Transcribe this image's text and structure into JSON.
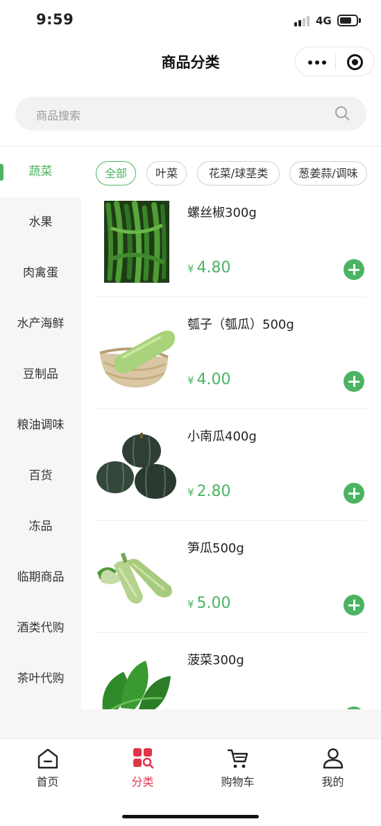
{
  "status_bar": {
    "time": "9:59",
    "network": "4G"
  },
  "navbar": {
    "title": "商品分类"
  },
  "search": {
    "placeholder": "商品搜索"
  },
  "sidebar": {
    "active_index": 0,
    "items": [
      {
        "label": "蔬菜"
      },
      {
        "label": "水果"
      },
      {
        "label": "肉禽蛋"
      },
      {
        "label": "水产海鲜"
      },
      {
        "label": "豆制品"
      },
      {
        "label": "粮油调味"
      },
      {
        "label": "百货"
      },
      {
        "label": "冻品"
      },
      {
        "label": "临期商品"
      },
      {
        "label": "酒类代购"
      },
      {
        "label": "茶叶代购"
      }
    ]
  },
  "subcategories": [
    {
      "label": "全部",
      "active": true
    },
    {
      "label": "叶菜",
      "active": false
    },
    {
      "label": "花菜/球茎类",
      "active": false
    },
    {
      "label": "葱姜蒜/调味",
      "active": false
    }
  ],
  "products": [
    {
      "name": "螺丝椒300g",
      "currency": "¥",
      "price": "4.80",
      "image": "green-peppers"
    },
    {
      "name": "瓠子（瓠瓜）500g",
      "currency": "¥",
      "price": "4.00",
      "image": "gourd-in-basket"
    },
    {
      "name": "小南瓜400g",
      "currency": "¥",
      "price": "2.80",
      "image": "small-pumpkins"
    },
    {
      "name": "笋瓜500g",
      "currency": "¥",
      "price": "5.00",
      "image": "zucchini"
    },
    {
      "name": "菠菜300g",
      "currency": "¥",
      "price": "",
      "image": "spinach"
    }
  ],
  "tabbar": {
    "active_index": 1,
    "tabs": [
      {
        "label": "首页",
        "icon": "home-icon"
      },
      {
        "label": "分类",
        "icon": "category-icon"
      },
      {
        "label": "购物车",
        "icon": "cart-icon"
      },
      {
        "label": "我的",
        "icon": "profile-icon"
      }
    ]
  },
  "colors": {
    "accent": "#4bb463",
    "tab_active": "#e0344a"
  }
}
